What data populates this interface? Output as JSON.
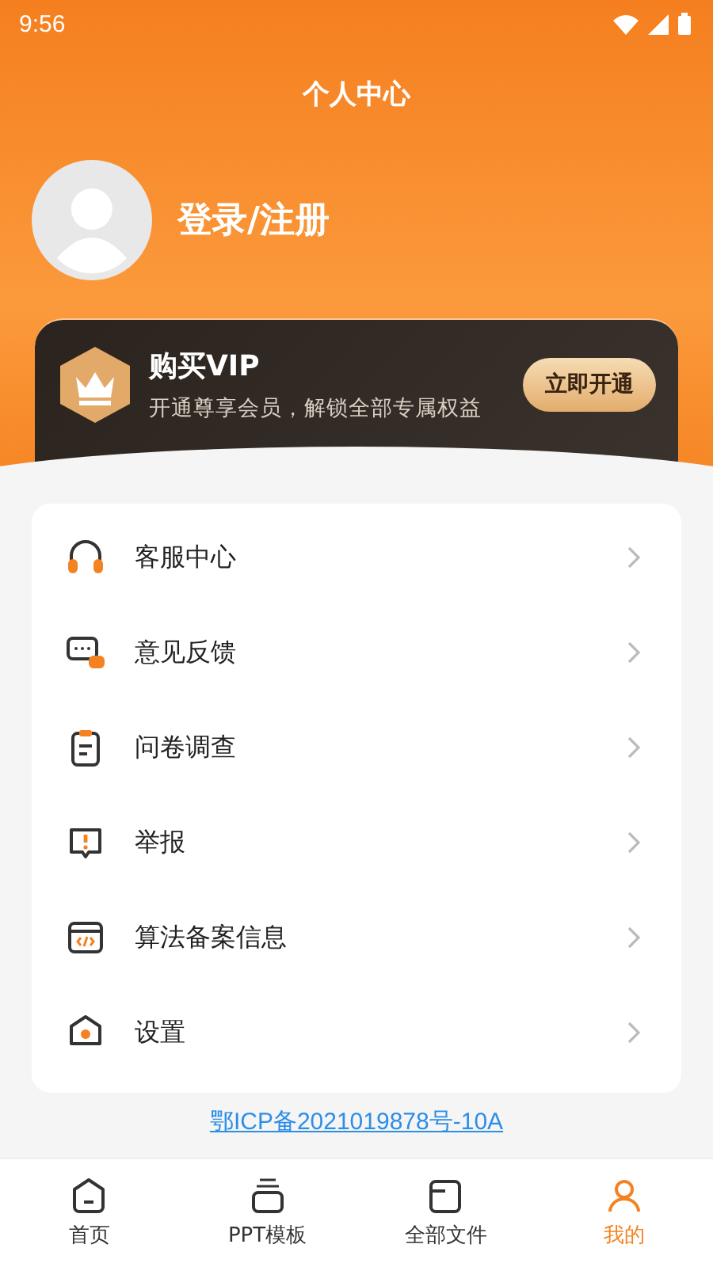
{
  "status_bar": {
    "time": "9:56"
  },
  "header": {
    "title": "个人中心"
  },
  "profile": {
    "login_label": "登录/注册"
  },
  "vip_card": {
    "title": "购买VIP",
    "subtitle": "开通尊享会员，解锁全部专属权益",
    "button": "立即开通"
  },
  "menu_items": [
    {
      "kind": "headset",
      "label": "客服中心"
    },
    {
      "kind": "chat",
      "label": "意见反馈"
    },
    {
      "kind": "clipboard",
      "label": "问卷调查"
    },
    {
      "kind": "report",
      "label": "举报"
    },
    {
      "kind": "code",
      "label": "算法备案信息"
    },
    {
      "kind": "settings",
      "label": "设置"
    }
  ],
  "icp_link": "鄂ICP备2021019878号-10A",
  "tabs": [
    {
      "kind": "home",
      "label": "首页",
      "selected": false
    },
    {
      "kind": "template",
      "label": "PPT模板",
      "selected": false
    },
    {
      "kind": "files",
      "label": "全部文件",
      "selected": false
    },
    {
      "kind": "me",
      "label": "我的",
      "selected": true
    }
  ]
}
